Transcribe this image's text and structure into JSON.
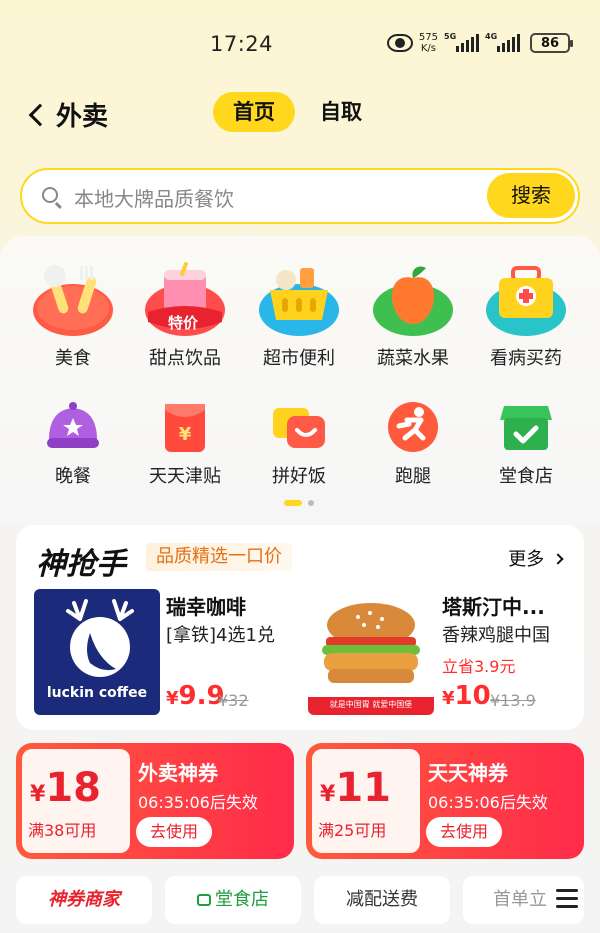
{
  "status_bar": {
    "time": "17:24",
    "net_speed_value": "575",
    "net_speed_unit": "K/s",
    "sim1_tag": "5G",
    "sim2_tag": "4G",
    "battery": "86"
  },
  "header": {
    "title": "外卖",
    "tabs": [
      {
        "label": "首页",
        "active": true
      },
      {
        "label": "自取",
        "active": false
      }
    ]
  },
  "search": {
    "placeholder": "本地大牌品质餐饮",
    "button_label": "搜索"
  },
  "categories": [
    {
      "label": "美食",
      "icon": "fork-spoon-icon"
    },
    {
      "label": "甜点饮品",
      "icon": "drink-cup-icon",
      "badge": "特价"
    },
    {
      "label": "超市便利",
      "icon": "shopping-basket-icon"
    },
    {
      "label": "蔬菜水果",
      "icon": "fruit-icon"
    },
    {
      "label": "看病买药",
      "icon": "medicine-box-icon"
    },
    {
      "label": "晚餐",
      "icon": "dinner-cloche-icon"
    },
    {
      "label": "天天津贴",
      "icon": "red-envelope-icon"
    },
    {
      "label": "拼好饭",
      "icon": "smile-box-icon"
    },
    {
      "label": "跑腿",
      "icon": "runner-icon"
    },
    {
      "label": "堂食店",
      "icon": "store-icon"
    }
  ],
  "flash_deal": {
    "title": "神抢手",
    "subtitle": "品质精选一口价",
    "more_label": "更多",
    "products": [
      {
        "name": "瑞幸咖啡",
        "desc": "[拿铁]4选1兑",
        "brand_text": "luckin coffee",
        "price_currency": "¥",
        "price": "9.9",
        "original_price": "¥32"
      },
      {
        "name": "塔斯汀中...",
        "desc": "香辣鸡腿中国",
        "savings": "立省3.9元",
        "banner_text": "就是中国胃 就爱中国堡",
        "price_currency": "¥",
        "price": "10",
        "original_price": "¥13.9"
      }
    ]
  },
  "coupons": [
    {
      "currency": "¥",
      "amount": "18",
      "condition": "满38可用",
      "title": "外卖神券",
      "timer": "06:35:06后失效",
      "button": "去使用"
    },
    {
      "currency": "¥",
      "amount": "11",
      "condition": "满25可用",
      "title": "天天神券",
      "timer": "06:35:06后失效",
      "button": "去使用"
    }
  ],
  "filters": [
    {
      "label": "神券商家"
    },
    {
      "label": "堂食店"
    },
    {
      "label": "减配送费"
    },
    {
      "label": "首单立"
    }
  ],
  "colors": {
    "accent_yellow": "#ffd81e",
    "price_red": "#ff2d2d",
    "coupon_red": "#ff2b4a",
    "tag_orange": "#e0701a"
  }
}
